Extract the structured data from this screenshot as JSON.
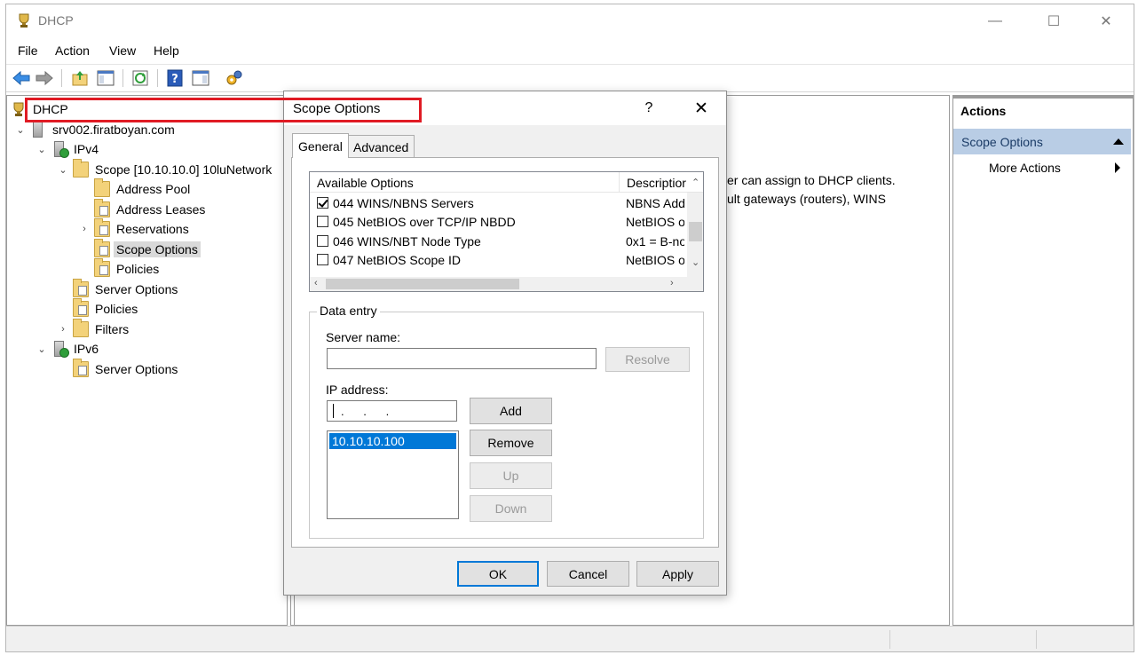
{
  "window": {
    "title": "DHCP",
    "controls": {
      "minimize": "—",
      "maximize": "☐",
      "close": "✕"
    }
  },
  "menu": [
    "File",
    "Action",
    "View",
    "Help"
  ],
  "toolbar": {
    "icons": [
      "back-arrow-icon",
      "forward-arrow-icon",
      "up-folder-icon",
      "show-hide-tree-icon",
      "refresh-icon",
      "help-icon",
      "show-hide-action-pane-icon",
      "dhcp-settings-icon"
    ]
  },
  "tree": {
    "root": "DHCP",
    "server": "srv002.firatboyan.com",
    "ipv4": "IPv4",
    "scope": "Scope [10.10.10.0] 10luNetwork",
    "address_pool": "Address Pool",
    "address_leases": "Address Leases",
    "reservations": "Reservations",
    "scope_options": "Scope Options",
    "scope_policies": "Policies",
    "server_options_v4": "Server Options",
    "policies_v4": "Policies",
    "filters": "Filters",
    "ipv6": "IPv6",
    "server_options_v6": "Server Options"
  },
  "center": {
    "text_line1": "er can assign to DHCP clients.",
    "text_line2": "ult gateways (routers), WINS"
  },
  "actions": {
    "header": "Actions",
    "section": "Scope Options",
    "more": "More Actions"
  },
  "dialog": {
    "title": "Scope Options",
    "help": "?",
    "close": "✕",
    "tabs": {
      "general": "General",
      "advanced": "Advanced"
    },
    "list": {
      "col_available": "Available Options",
      "col_description": "Descriptior",
      "rows": [
        {
          "name": "044 WINS/NBNS Servers",
          "desc": "NBNS Add",
          "checked": true
        },
        {
          "name": "045 NetBIOS over TCP/IP NBDD",
          "desc": "NetBIOS o",
          "checked": false
        },
        {
          "name": "046 WINS/NBT Node Type",
          "desc": "0x1 = B-no",
          "checked": false
        },
        {
          "name": "047 NetBIOS Scope ID",
          "desc": "NetBIOS o",
          "checked": false
        }
      ]
    },
    "data_entry": {
      "legend": "Data entry",
      "server_name_label": "Server name:",
      "server_name_value": "",
      "resolve": "Resolve",
      "ip_label": "IP address:",
      "ip_value": ".      .      .",
      "add": "Add",
      "remove": "Remove",
      "up": "Up",
      "down": "Down",
      "ip_list": [
        "10.10.10.100"
      ]
    },
    "buttons": {
      "ok": "OK",
      "cancel": "Cancel",
      "apply": "Apply"
    }
  }
}
